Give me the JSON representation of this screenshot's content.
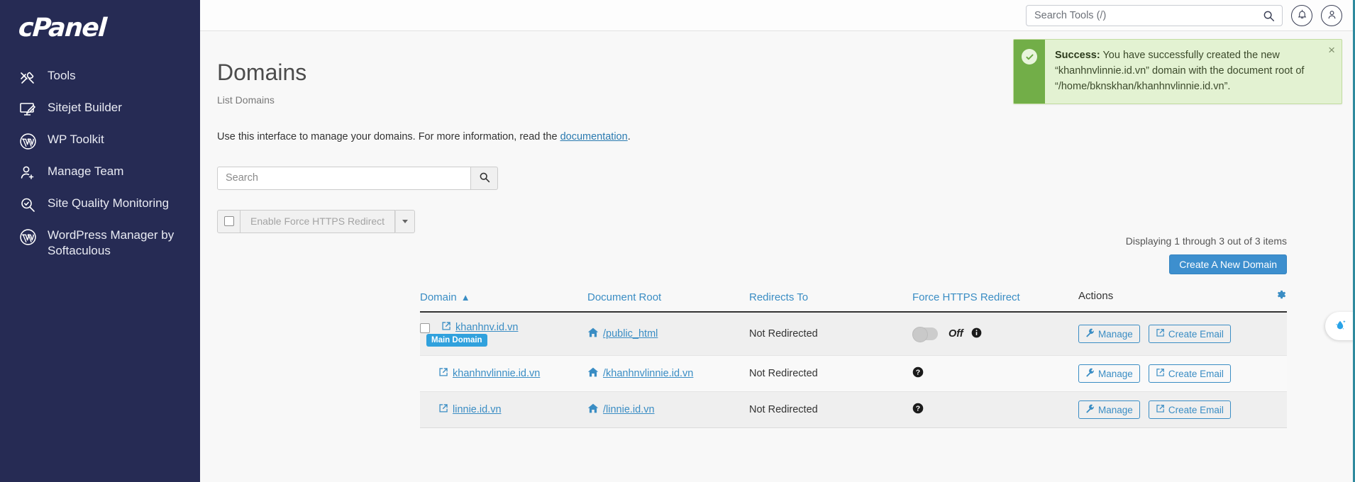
{
  "sidebar": {
    "logo": "cPanel",
    "items": [
      {
        "label": "Tools",
        "icon": "tools-icon"
      },
      {
        "label": "Sitejet Builder",
        "icon": "monitor-pen-icon"
      },
      {
        "label": "WP Toolkit",
        "icon": "wordpress-icon"
      },
      {
        "label": "Manage Team",
        "icon": "user-plus-icon"
      },
      {
        "label": "Site Quality Monitoring",
        "icon": "magnifier-check-icon"
      },
      {
        "label": "WordPress Manager by Softaculous",
        "icon": "wordpress-icon"
      }
    ]
  },
  "topbar": {
    "search_placeholder": "Search Tools (/)",
    "search_value": "",
    "search_icon": "search-icon",
    "notifications_icon": "bell-icon",
    "account_icon": "user-icon"
  },
  "alert": {
    "icon": "check-circle-icon",
    "title": "Success:",
    "message": " You have successfully created the new “khanhnvlinnie.id.vn” domain with the document root of “/home/bknskhan/khanhnvlinnie.id.vn”.",
    "close_label": "×",
    "accent_color": "#72ae48",
    "background_color": "#e3f2d2"
  },
  "page": {
    "title": "Domains",
    "breadcrumb": "List Domains",
    "intro_before": "Use this interface to manage your domains. For more information, read the ",
    "intro_link": "documentation",
    "intro_after": "."
  },
  "search": {
    "placeholder": "Search",
    "value": "",
    "button_icon": "search-icon"
  },
  "toolbar": {
    "select_all_label": "",
    "bulk_action_label": "Enable Force HTTPS Redirect",
    "dropdown_icon": "chevron-down-icon",
    "count_text": "Displaying 1 through 3 out of 3 items",
    "create_label": "Create A New Domain",
    "create_color": "#3d8fce"
  },
  "table": {
    "gear_icon": "gear-icon",
    "sort_icon": "caret-up-icon",
    "columns": [
      {
        "label": "Domain",
        "sorted": true,
        "sortable": true
      },
      {
        "label": "Document Root",
        "sorted": false,
        "sortable": true
      },
      {
        "label": "Redirects To",
        "sorted": false,
        "sortable": true
      },
      {
        "label": "Force HTTPS Redirect",
        "sorted": false,
        "sortable": true
      },
      {
        "label": "Actions",
        "sorted": false,
        "sortable": false
      }
    ],
    "rows": [
      {
        "checkbox": true,
        "domain": "khanhnv.id.vn",
        "domain_icon": "external-link-icon",
        "badge": "Main Domain",
        "document_root": "/public_html",
        "root_icon": "home-icon",
        "redirects_to": "Not Redirected",
        "https_control": "toggle",
        "https_state": "Off",
        "https_info_icon": "info-icon",
        "actions": [
          {
            "label": "Manage",
            "icon": "wrench-icon"
          },
          {
            "label": "Create Email",
            "icon": "external-link-icon"
          }
        ]
      },
      {
        "checkbox": false,
        "domain": "khanhnvlinnie.id.vn",
        "domain_icon": "external-link-icon",
        "badge": "",
        "document_root": "/khanhnvlinnie.id.vn",
        "root_icon": "home-icon",
        "redirects_to": "Not Redirected",
        "https_control": "unknown",
        "https_state": "",
        "https_info_icon": "question-circle-icon",
        "actions": [
          {
            "label": "Manage",
            "icon": "wrench-icon"
          },
          {
            "label": "Create Email",
            "icon": "external-link-icon"
          }
        ]
      },
      {
        "checkbox": false,
        "domain": "linnie.id.vn",
        "domain_icon": "external-link-icon",
        "badge": "",
        "document_root": "/linnie.id.vn",
        "root_icon": "home-icon",
        "redirects_to": "Not Redirected",
        "https_control": "unknown",
        "https_state": "",
        "https_info_icon": "question-circle-icon",
        "actions": [
          {
            "label": "Manage",
            "icon": "wrench-icon"
          },
          {
            "label": "Create Email",
            "icon": "external-link-icon"
          }
        ]
      }
    ]
  },
  "float_widget": {
    "icon": "water-drop-sparkle-icon"
  }
}
